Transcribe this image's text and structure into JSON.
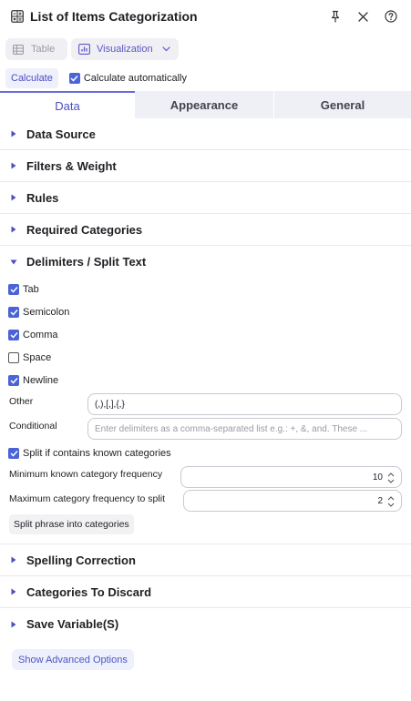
{
  "window": {
    "title": "List of Items Categorization",
    "icons": [
      "calculator-icon",
      "pin-icon",
      "close-icon",
      "help-icon"
    ]
  },
  "view_buttons": {
    "table": "Table",
    "visualization": "Visualization"
  },
  "calc": {
    "label": "Calculate",
    "auto_label": "Calculate automatically",
    "auto_checked": true
  },
  "tabs": [
    "Data",
    "Appearance",
    "General"
  ],
  "active_tab": "Data",
  "sections": {
    "data_source": "Data Source",
    "filters_weight": "Filters & Weight",
    "rules": "Rules",
    "required_categories": "Required Categories",
    "delimiters": "Delimiters / Split Text",
    "spelling": "Spelling Correction",
    "discard": "Categories To Discard",
    "save_variables": "Save Variable(S)"
  },
  "delimiters": {
    "options": [
      {
        "label": "Tab",
        "checked": true
      },
      {
        "label": "Semicolon",
        "checked": true
      },
      {
        "label": "Comma",
        "checked": true
      },
      {
        "label": "Space",
        "checked": false
      },
      {
        "label": "Newline",
        "checked": true
      }
    ],
    "other_label": "Other",
    "other_value": "(,),[,],{,}",
    "conditional_label": "Conditional",
    "conditional_placeholder": "Enter delimiters as a comma-separated list e.g.: +, &, and. These ...",
    "split_known_label": "Split if contains known categories",
    "split_known_checked": true,
    "min_freq_label": "Minimum known category frequency",
    "min_freq_value": "10",
    "max_freq_label": "Maximum category frequency to split",
    "max_freq_value": "2",
    "split_phrase_button": "Split phrase into categories"
  },
  "advanced_button": "Show Advanced Options",
  "colors": {
    "accent": "#4a63d6",
    "accent_text": "#4a4ec2",
    "tab_inactive_bg": "#eef0f5"
  }
}
